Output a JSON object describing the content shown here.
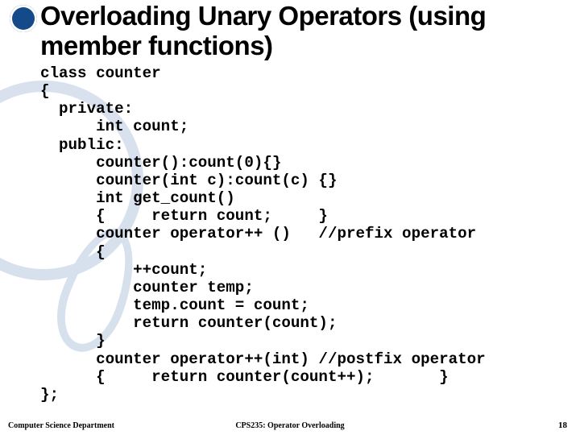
{
  "title": "Overloading Unary Operators (using member functions)",
  "code_lines": [
    "class counter",
    "{",
    "  private:",
    "      int count;",
    "  public:",
    "      counter():count(0){}",
    "      counter(int c):count(c) {}",
    "      int get_count()",
    "      {     return count;     }",
    "      counter operator++ ()   //prefix operator",
    "      {",
    "          ++count;",
    "          counter temp;",
    "          temp.count = count;",
    "          return counter(count);",
    "      }",
    "      counter operator++(int) //postfix operator",
    "      {     return counter(count++);       }",
    "};"
  ],
  "footer": {
    "left": "Computer Science Department",
    "center": "CPS235: Operator Overloading",
    "page_number": "18"
  },
  "emblem_alt": "university-crest"
}
